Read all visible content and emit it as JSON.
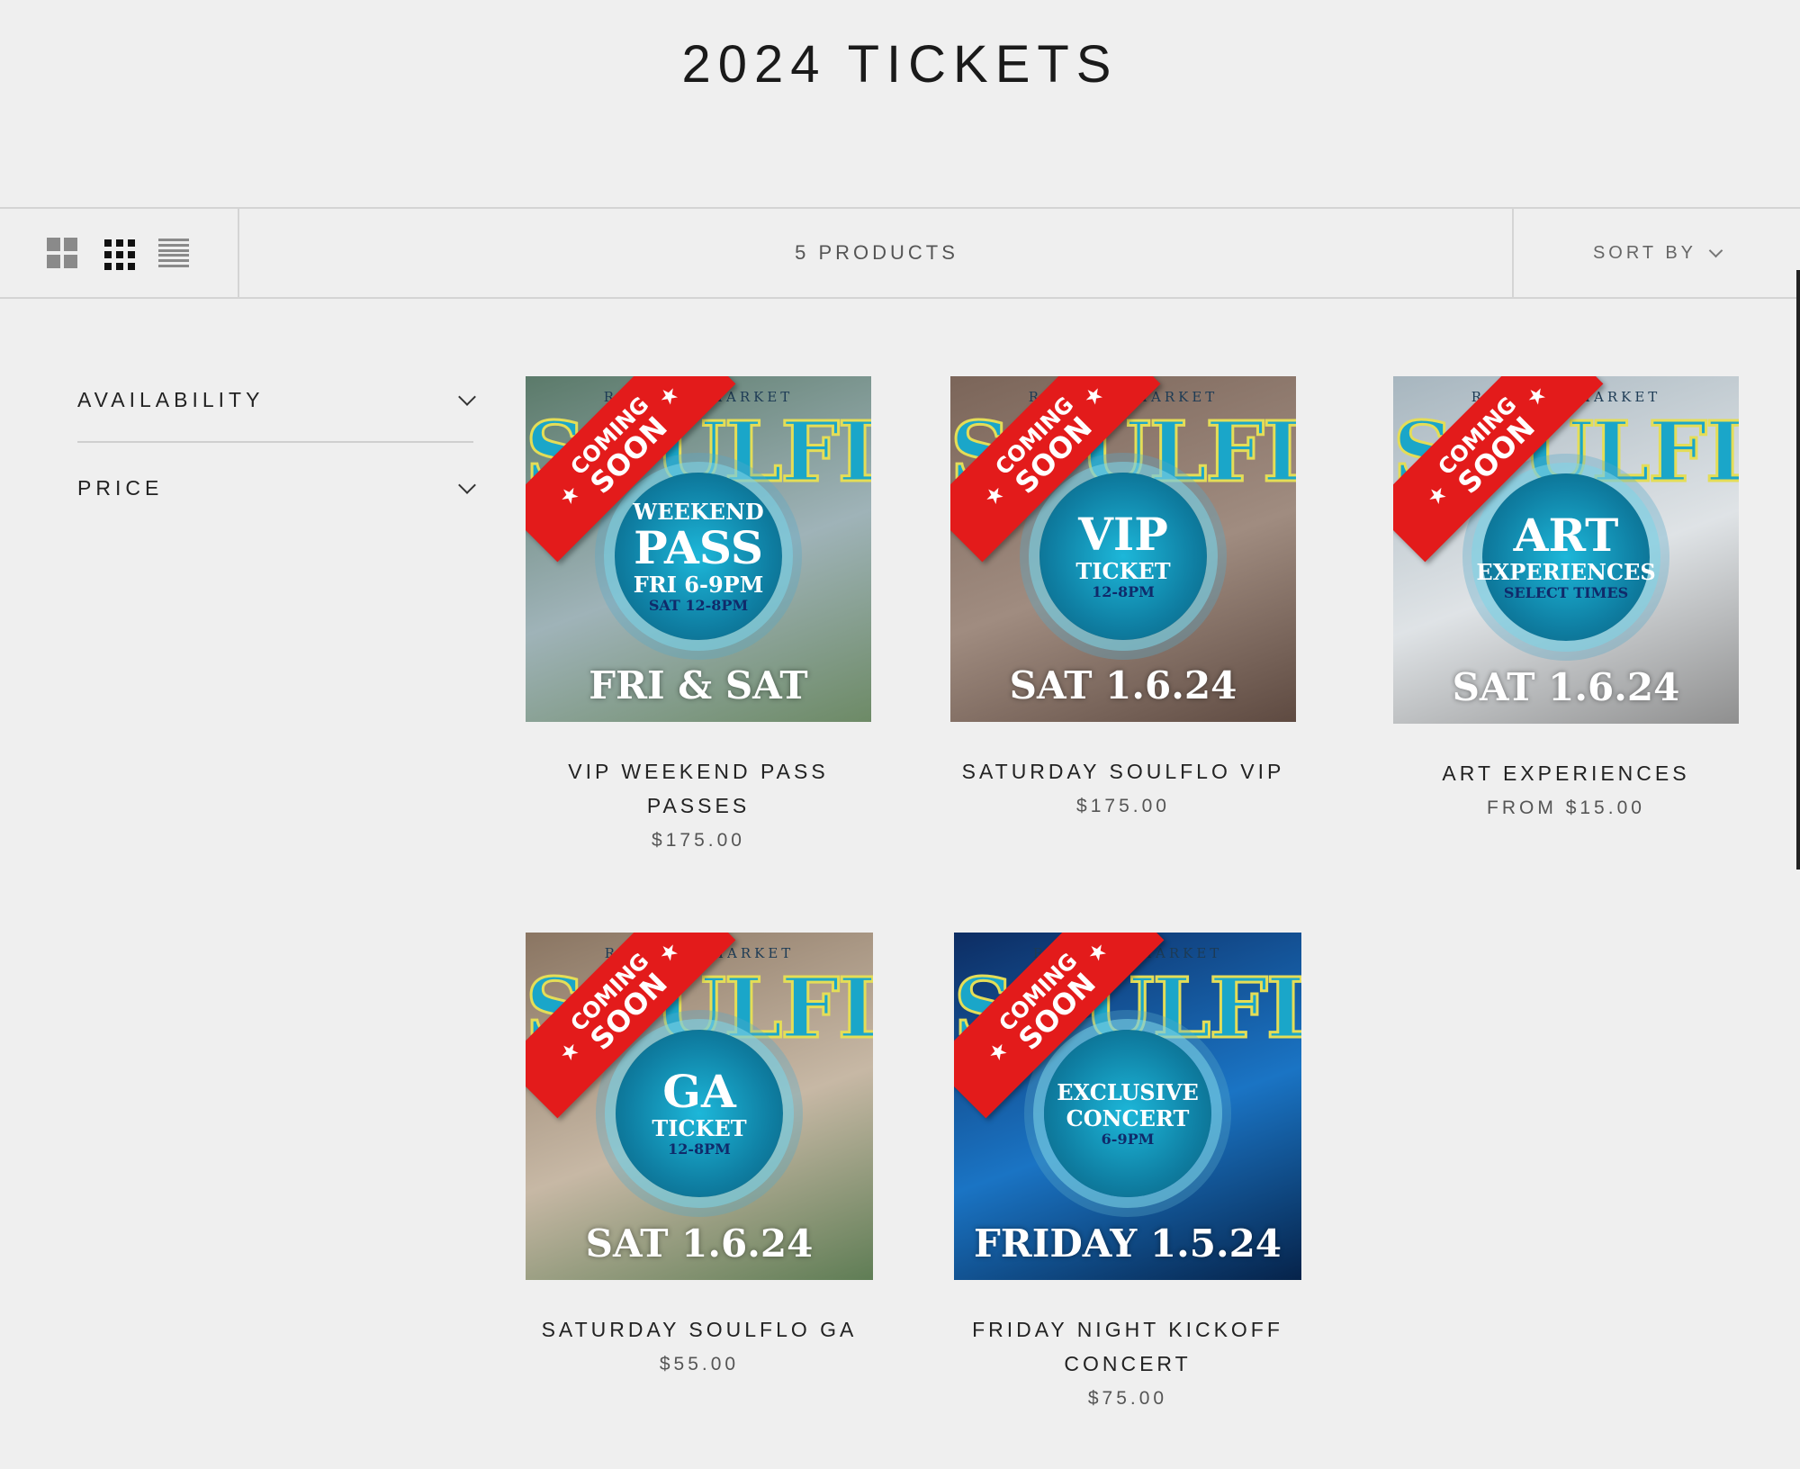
{
  "page": {
    "title": "2024 TICKETS"
  },
  "toolbar": {
    "product_count": "5 PRODUCTS",
    "sort_label": "SORT BY",
    "layout_icons": [
      "grid-2x2-icon",
      "grid-3x3-icon",
      "list-icon"
    ]
  },
  "filters": [
    {
      "label": "AVAILABILITY"
    },
    {
      "label": "PRICE"
    }
  ],
  "products": [
    {
      "name_line1": "VIP WEEKEND PASS",
      "name_line2": "PASSES",
      "price": "$175.00",
      "art": {
        "badge_top": "COMING",
        "badge_bottom": "SOON",
        "header": "RAINBOW MARKET",
        "brand": "SOULFLO",
        "ring_line1": "WEEKEND",
        "ring_line2": "PASS",
        "ring_line3": "FRI 6-9PM",
        "ring_line4": "SAT 12-8PM",
        "bottom": "FRI & SAT",
        "bg": [
          "#5b7a6a",
          "#9fb3b8",
          "#6d8a66"
        ]
      }
    },
    {
      "name_line1": "SATURDAY SOULFLO VIP",
      "name_line2": "",
      "price": "$175.00",
      "art": {
        "badge_top": "COMING",
        "badge_bottom": "SOON",
        "header": "RAINBOW MARKET",
        "brand": "SOULFLO",
        "ring_line1": "",
        "ring_line2": "VIP",
        "ring_line3": "TICKET",
        "ring_line4": "12-8PM",
        "bottom": "SAT 1.6.24",
        "bg": [
          "#7b6559",
          "#a08c80",
          "#5e4a41"
        ]
      }
    },
    {
      "name_line1": "ART EXPERIENCES",
      "name_line2": "",
      "price": "FROM $15.00",
      "art": {
        "badge_top": "COMING",
        "badge_bottom": "SOON",
        "header": "RAINBOW MARKET",
        "brand": "SOULFLO",
        "ring_line1": "",
        "ring_line2": "ART",
        "ring_line3": "EXPERIENCES",
        "ring_line4": "SELECT TIMES",
        "bottom": "SAT 1.6.24",
        "bg": [
          "#a7b6bf",
          "#dfe3e6",
          "#8f8f8f"
        ]
      }
    },
    {
      "name_line1": "SATURDAY SOULFLO GA",
      "name_line2": "",
      "price": "$55.00",
      "art": {
        "badge_top": "COMING",
        "badge_bottom": "SOON",
        "header": "RAINBOW MARKET",
        "brand": "SOULFLO",
        "ring_line1": "",
        "ring_line2": "GA",
        "ring_line3": "TICKET",
        "ring_line4": "12-8PM",
        "bottom": "SAT 1.6.24",
        "bg": [
          "#8a7562",
          "#c7b8a5",
          "#5f7d55"
        ]
      }
    },
    {
      "name_line1": "FRIDAY NIGHT KICKOFF",
      "name_line2": "CONCERT",
      "price": "$75.00",
      "art": {
        "badge_top": "COMING",
        "badge_bottom": "SOON",
        "header": "RAINBOW MARKET",
        "brand": "SOULFLO",
        "ring_line1": "EXCLUSIVE",
        "ring_line2": "",
        "ring_line3": "CONCERT",
        "ring_line4": "6-9PM",
        "bottom": "FRIDAY 1.5.24",
        "bg": [
          "#0d2d63",
          "#1a74c4",
          "#06234a"
        ]
      }
    }
  ]
}
